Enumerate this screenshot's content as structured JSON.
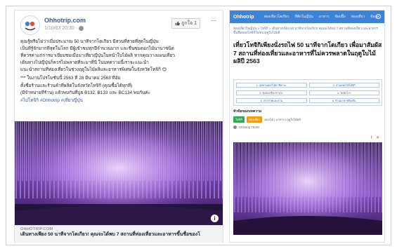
{
  "facebook_post": {
    "page_name": "Ohhotrip.com",
    "timestamp": "1/10/63 20:30 ·",
    "like_button": "ถูกใจ 1",
    "more": "···",
    "body_lines": [
      "คุณรู้หรือไม่ว่าเมื่อประมาณ 50 นาทีจากโตเกียว มีสวนที่สวยที่สุดในญี่ปุ่น",
      "เป็นที่รู้จักมากที่สุดในโลก มีผู้เข้าชมทุกปีจำนวนมาก และชื่นชมดอกไม้นานาชนิด",
      "ที่ควรค่าแก่การมาเยี่ยมชมเมื่อมาเที่ยวญี่ปุ่นในหน้าใบไม้ผลิ หากคุณวางแผนเที่ยว",
      "เดินทางไปญี่ปุ่นก็ควรไม่พลาดที่จะมาที่นี่ ในบทความนี้เราจะแนะนำ",
      "แนะนำสถานที่ท่องเที่ยวในช่วงฤดูใบไม้ผลิและอาหารพิเศษในจังหวัดโทจิกิ 😊"
    ],
    "body_lines_2": [
      "*** ในงานโปรโมชั่นนี้ 2563 ที่ 28 มีนาคม 2563 ที่อัม",
      "ตั้งชื่อร้านและร้านค้าที่ผลิตในจังหวัดโทจิกิ (คุณซื้อได้ทุกที่)",
      "(มีจำหน่ายที่ร้าน) แล้วพบกันที่บูธ B132, B133 และ BC134 พบกันค่ะ"
    ],
    "hashtags": "#ไปโทจิกิ #Ohhotrip #เที่ยวญี่ปุ่น",
    "image_info": "i",
    "link_domain": "OHHOTRIP.COM",
    "link_title": "เดินทางเพียง 50 นาทีจากโตเกียว! คุณจะได้พบ 7 สถานที่ท่องเที่ยวและอาหารขึ้นชื่อของโ"
  },
  "website": {
    "logo": "Ohhotrip",
    "menu": [
      "ท่องเที่ยวโตเกียว",
      "ที่พักในญี่ปุ่น",
      "อาหาร",
      "ช้อปปิ้ง",
      "ท่องเที่ยว",
      "ข้อมูล"
    ],
    "breadcrumb": "ท่องเที่ยวในญี่ปุ่น > โทจิกิ > เดินทางเพียง 50 นาทีจากโตเกียว! คุณจะได้พบ 7 สถานที่ท่องเที่ยว และอาหารขึ้นชื่อของโทจิกิในช่วงฤดูใบไม้ผลิ",
    "title": "เที่ยวโทจิกิเพียงนั่งรถไฟ 50 นาทีจากโตเกียว เพื่อมาสัมผัส 7 สถานที่ท่องเที่ยวและอาหารที่ไม่ควรพลาดในฤดูใบไม้ผลิปี 2563",
    "toc": [
      "1. อุทยานดอกไม้อาชิคางะ",
      "2. สวนดอกไม้โทจิกิ",
      "3. ทุ่งดอกชิบะซากุระ",
      "4. วัดนิกโกะ",
      "5. ปราสาทและสวน",
      "6. ร้านอาหารท้องถิ่น"
    ],
    "meta_label": "หัวข้อของบทความ",
    "tags": [
      "โทจิกิ",
      "ท่องเที่ยว"
    ],
    "tag_text": "ดอกไม้ | อาหาร | ฤดูใบไม้ผลิ",
    "author": "Ohhotrip TEAM",
    "share": "f ✕"
  },
  "colors": {
    "fb_link_blue": "#385898",
    "site_blue": "#3b82d9",
    "wisteria_purple": "#b07be0"
  }
}
